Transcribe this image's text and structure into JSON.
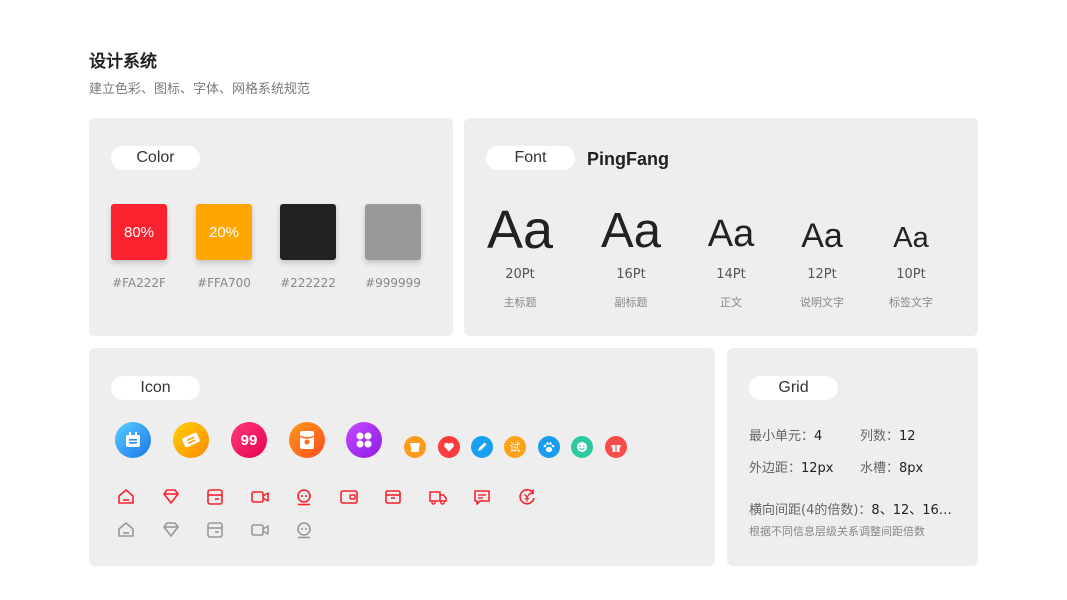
{
  "header": {
    "title": "设计系统",
    "subtitle": "建立色彩、图标、字体、网格系统规范"
  },
  "color_section": {
    "label": "Color",
    "swatches": [
      {
        "hex": "#FA222F",
        "label": "#FA222F",
        "text": "80%"
      },
      {
        "hex": "#FFA700",
        "label": "#FFA700",
        "text": "20%"
      },
      {
        "hex": "#222222",
        "label": "#222222",
        "text": ""
      },
      {
        "hex": "#999999",
        "label": "#999999",
        "text": ""
      }
    ]
  },
  "font_section": {
    "label": "Font",
    "family_name": "PingFang",
    "samples": [
      {
        "glyph": "Aa",
        "size": "20Pt",
        "role": "主标题"
      },
      {
        "glyph": "Aa",
        "size": "16Pt",
        "role": "副标题"
      },
      {
        "glyph": "Aa",
        "size": "14Pt",
        "role": "正文"
      },
      {
        "glyph": "Aa",
        "size": "12Pt",
        "role": "说明文字"
      },
      {
        "glyph": "Aa",
        "size": "10Pt",
        "role": "标签文字"
      }
    ]
  },
  "icon_section": {
    "label": "Icon",
    "large_icons": [
      "calendar-icon",
      "ticket-icon",
      "ninety-nine-icon",
      "red-envelope-icon",
      "category-grid-icon"
    ],
    "small_icons": [
      "shop-icon",
      "heart-icon",
      "pencil-icon",
      "trial-icon",
      "paw-icon",
      "smile-icon",
      "gift-icon"
    ],
    "small_trial_text": "试",
    "line_icons_red": [
      "home-icon",
      "diamond-icon",
      "wallet-card-icon",
      "video-icon",
      "robot-icon",
      "purse-icon",
      "box-icon",
      "delivery-truck-icon",
      "message-icon",
      "yuan-refresh-icon"
    ],
    "line_icons_gray": [
      "home-icon",
      "diamond-icon",
      "wallet-card-icon",
      "video-icon",
      "robot-icon"
    ],
    "colors": {
      "line_red": "#FA222F",
      "line_gray": "#999999"
    }
  },
  "grid_section": {
    "label": "Grid",
    "min_unit_label": "最小单元：",
    "min_unit_value": "4",
    "columns_label": "列数：",
    "columns_value": "12",
    "margin_label": "外边距：",
    "margin_value": "12px",
    "gutter_label": "水槽：",
    "gutter_value": "8px",
    "spacing_label": "横向间距(4的倍数)：",
    "spacing_value": "8、12、16…",
    "note": "根据不同信息层级关系调整间距倍数"
  }
}
